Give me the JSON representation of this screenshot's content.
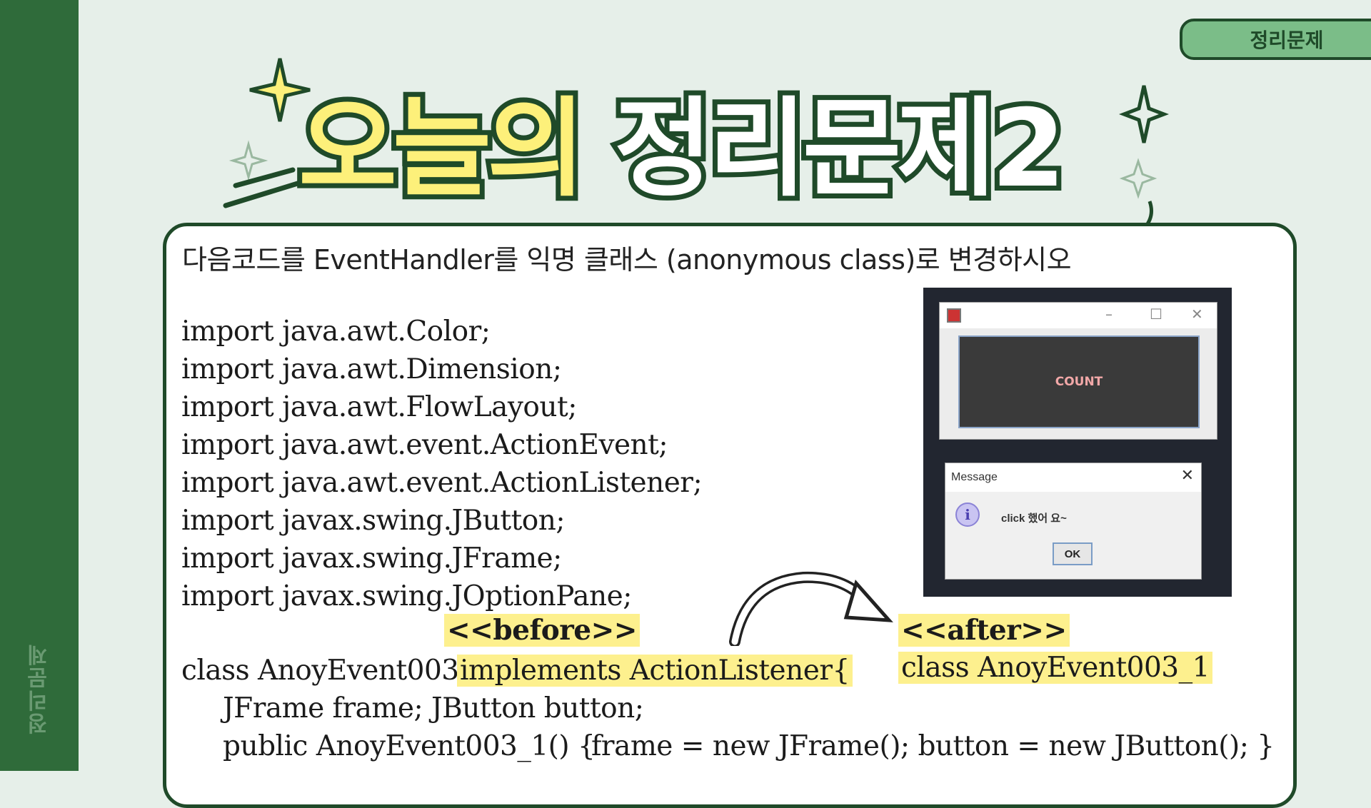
{
  "side_label": "정리문제",
  "tab_label": "정리문제",
  "title": {
    "part1": "오늘의",
    "part2": "정리문제2"
  },
  "instruction": "다음코드를 EventHandler를 익명 클래스 (anonymous class)로 변경하시오",
  "imports": [
    "import java.awt.Color;",
    "import java.awt.Dimension;",
    "import java.awt.FlowLayout;",
    "import java.awt.event.ActionEvent;",
    "import java.awt.event.ActionListener;",
    "import javax.swing.JButton;",
    "import javax.swing.JFrame;",
    "import javax.swing.JOptionPane;"
  ],
  "before_tag": "<<before>>",
  "after_tag": "<<after>>",
  "class_decl": "class AnoyEvent003_1",
  "implements_text": "implements ActionListener{",
  "after_class": "class AnoyEvent003_1",
  "field_line": "JFrame frame; JButton button;",
  "ctor_line": "public AnoyEvent003_1() {",
  "ctor_body": "frame = new JFrame();  button = new JButton(); }",
  "screenshot": {
    "frame_controls": [
      "–",
      "☐",
      "✕"
    ],
    "button_label": "COUNT",
    "message_title": "Message",
    "message_close": "✕",
    "info_glyph": "i",
    "message_text": "click 했어 요~",
    "ok_label": "OK"
  },
  "colors": {
    "dark_green": "#1f4a29",
    "band_green": "#2f6b3a",
    "title_yellow": "#fdf07a",
    "highlight": "#fdf08e"
  }
}
